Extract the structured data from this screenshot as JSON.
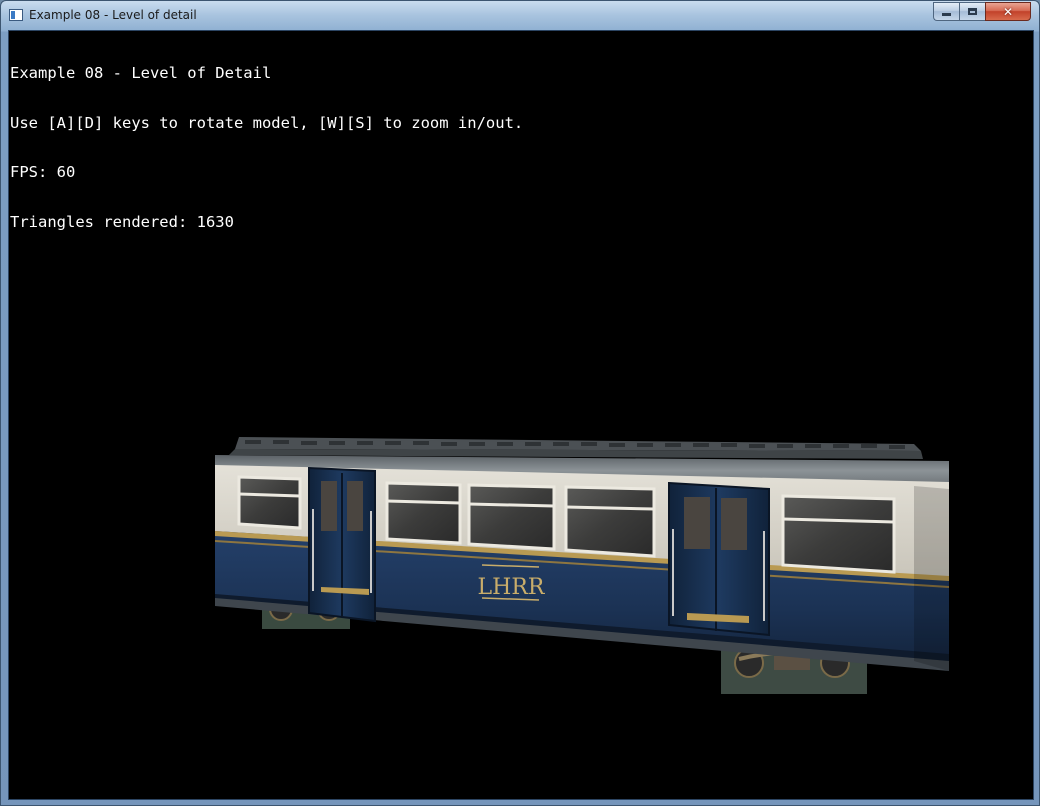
{
  "window": {
    "title": "Example 08 - Level of detail",
    "minimize_label": "minimize",
    "maximize_label": "maximize",
    "close_label": "✕"
  },
  "overlay": {
    "line1": "Example 08 - Level of Detail",
    "line2": "Use [A][D] keys to rotate model, [W][S] to zoom in/out.",
    "line3": "FPS: 60",
    "line4": "Triangles rendered: 1630"
  },
  "scene": {
    "model": "train-carriage",
    "logo_text": "LHRR",
    "colors": {
      "background": "#000000",
      "body_blue": "#1c3150",
      "body_cream": "#d9d6cd",
      "trim_gold": "#b99a52",
      "roof": "#7d8489"
    }
  }
}
